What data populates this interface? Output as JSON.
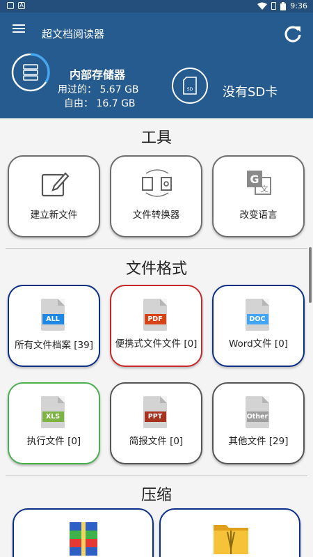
{
  "status_bar": {
    "time": "9:36",
    "left_icons": [
      "sd-card-icon",
      "a-icon"
    ],
    "right_icons": [
      "wifi-icon",
      "lock-icon",
      "battery-icon"
    ]
  },
  "app_bar": {
    "title": "超文档阅读器",
    "menu_icon": "hamburger-menu-icon",
    "refresh_icon": "refresh-icon"
  },
  "storage": {
    "title": "内部存储器",
    "used_label": "用过的：",
    "used_value": "5.67 GB",
    "free_label": "自由：",
    "free_value": "16.7 GB",
    "used_fraction": 0.34,
    "sd_label": "没有SD卡"
  },
  "tools": {
    "title": "工具",
    "items": [
      {
        "label": "建立新文件",
        "icon": "new-file-icon"
      },
      {
        "label": "文件转换器",
        "icon": "file-converter-icon"
      },
      {
        "label": "改变语言",
        "icon": "language-icon"
      }
    ]
  },
  "formats": {
    "title": "文件格式",
    "items": [
      {
        "label": "所有文件档案 [39]",
        "tag": "ALL",
        "tag_color": "#1e88e5",
        "border_color": "#0b2e86"
      },
      {
        "label": "便携式文件文件 [0]",
        "tag": "PDF",
        "tag_color": "#d84315",
        "border_color": "#c62828"
      },
      {
        "label": "Word文件 [0]",
        "tag": "DOC",
        "tag_color": "#42a5f5",
        "border_color": "#0b2e86"
      },
      {
        "label": "执行文件 [0]",
        "tag": "XLS",
        "tag_color": "#7cb342",
        "border_color": "#4caf50"
      },
      {
        "label": "简报文件 [0]",
        "tag": "PPT",
        "tag_color": "#a8321e",
        "border_color": "#555555"
      },
      {
        "label": "其他文件 [29]",
        "tag": "Other",
        "tag_color": "#9e9e9e",
        "border_color": "#555555"
      }
    ]
  },
  "compression": {
    "title": "压缩",
    "items": [
      {
        "icon": "rar-archive-icon"
      },
      {
        "icon": "zip-folder-icon"
      }
    ]
  }
}
